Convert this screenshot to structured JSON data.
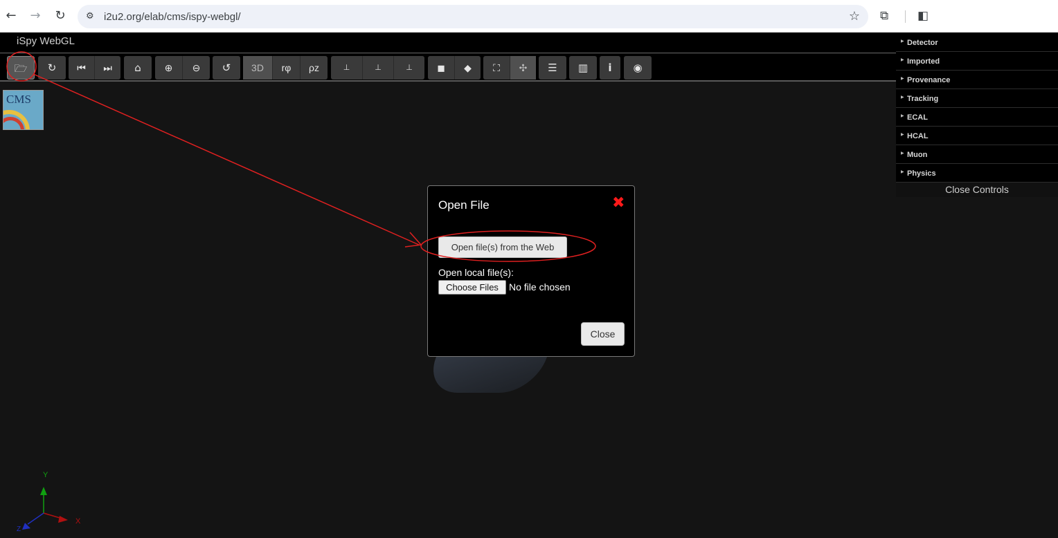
{
  "browser": {
    "url": "i2u2.org/elab/cms/ispy-webgl/",
    "back": "←",
    "forward": "→",
    "reload": "↻"
  },
  "app": {
    "title": "iSpy WebGL"
  },
  "toolbar": {
    "view_3d": "3D",
    "view_rphi": "rφ",
    "view_rhoz": "ρz"
  },
  "controls": {
    "items": [
      "Detector",
      "Imported",
      "Provenance",
      "Tracking",
      "ECAL",
      "HCAL",
      "Muon",
      "Physics"
    ],
    "close": "Close Controls"
  },
  "modal": {
    "title": "Open File",
    "web_button": "Open file(s) from the Web",
    "local_label": "Open local file(s):",
    "choose_button": "Choose Files",
    "no_file": "No file chosen",
    "close_button": "Close"
  },
  "logo": {
    "text": "CMS"
  },
  "axes": {
    "y": "Y",
    "x": "X",
    "z": "Z"
  },
  "colors": {
    "annotation": "#e02020",
    "modal_close": "#ff1a1a",
    "axis_x": "#b01010",
    "axis_y": "#10a010",
    "axis_z": "#2030c0"
  }
}
